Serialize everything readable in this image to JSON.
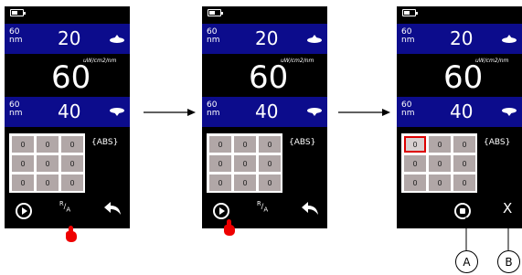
{
  "screens": [
    {
      "top": {
        "wavelength_value": "60",
        "wavelength_unit": "nm",
        "value": "20"
      },
      "unit": "uW/cm2/nm",
      "reading": "60",
      "bottom": {
        "wavelength_value": "60",
        "wavelength_unit": "nm",
        "value": "40"
      },
      "grid": [
        "0",
        "0",
        "0",
        "0",
        "0",
        "0",
        "0",
        "0",
        "0"
      ],
      "mode_label": "{ABS}",
      "toolbar": {
        "ra_r": "R",
        "ra_a": "A"
      }
    },
    {
      "top": {
        "wavelength_value": "60",
        "wavelength_unit": "nm",
        "value": "20"
      },
      "unit": "uW/cm2/nm",
      "reading": "60",
      "bottom": {
        "wavelength_value": "60",
        "wavelength_unit": "nm",
        "value": "40"
      },
      "grid": [
        "0",
        "0",
        "0",
        "0",
        "0",
        "0",
        "0",
        "0",
        "0"
      ],
      "mode_label": "{ABS}",
      "toolbar": {
        "ra_r": "R",
        "ra_a": "A"
      }
    },
    {
      "top": {
        "wavelength_value": "60",
        "wavelength_unit": "nm",
        "value": "20"
      },
      "unit": "uW/cm2/nm",
      "reading": "60",
      "bottom": {
        "wavelength_value": "60",
        "wavelength_unit": "nm",
        "value": "40"
      },
      "grid": [
        "0",
        "0",
        "0",
        "0",
        "0",
        "0",
        "0",
        "0",
        "0"
      ],
      "mode_label": "{ABS}",
      "toolbar": {
        "cancel_label": "X"
      }
    }
  ],
  "callouts": {
    "a": "A",
    "b": "B"
  },
  "colors": {
    "band": "#0c0c8c",
    "cell": "#b1a7a7",
    "highlight": "#dd0000",
    "screen": "#000000"
  },
  "icons": [
    "battery-icon",
    "lamp-up-icon",
    "lamp-down-icon",
    "play-icon",
    "back-arrow-icon",
    "stop-icon",
    "hand-pointer-icon",
    "arrow-right-icon"
  ]
}
